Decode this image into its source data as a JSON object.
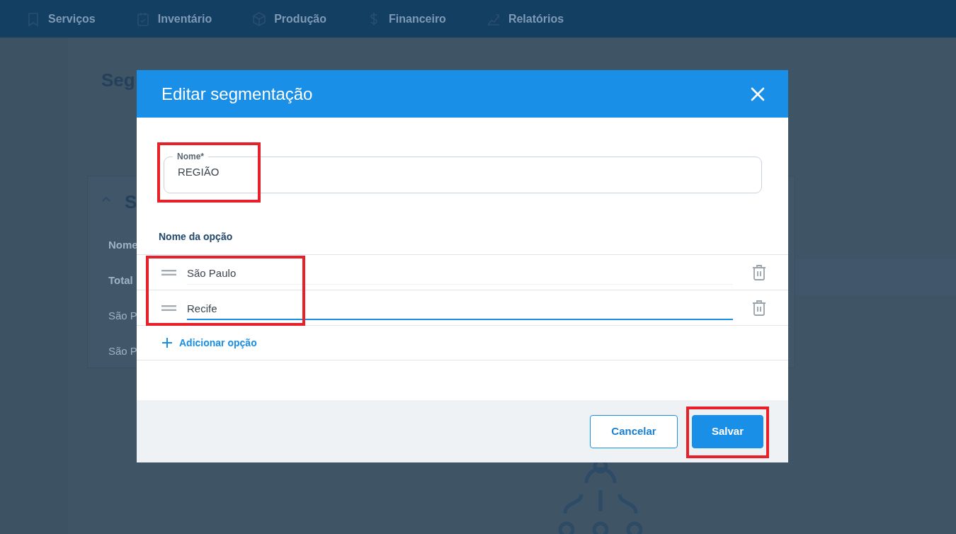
{
  "nav": [
    {
      "label": "Serviços"
    },
    {
      "label": "Inventário"
    },
    {
      "label": "Produção"
    },
    {
      "label": "Financeiro"
    },
    {
      "label": "Relatórios"
    }
  ],
  "background_page": {
    "title": "Seg",
    "card_title": "S",
    "table_header": "Nome",
    "rows": [
      {
        "text": "Total",
        "kind": "total"
      },
      {
        "text": "São P",
        "kind": "item"
      },
      {
        "text": "São P",
        "kind": "item"
      }
    ]
  },
  "dialog": {
    "title": "Editar segmentação",
    "name_field": {
      "label": "Nome*",
      "value": "REGIÃO",
      "highlighted": true
    },
    "options_heading": "Nome da opção",
    "options_highlighted": true,
    "options": [
      {
        "value": "São Paulo",
        "focused": false
      },
      {
        "value": "Recife",
        "focused": true
      }
    ],
    "add_option": "Adicionar opção",
    "buttons": [
      {
        "label": "Cancelar",
        "kind": "secondary",
        "highlighted": false
      },
      {
        "label": "Salvar",
        "kind": "primary",
        "highlighted": true
      }
    ]
  }
}
